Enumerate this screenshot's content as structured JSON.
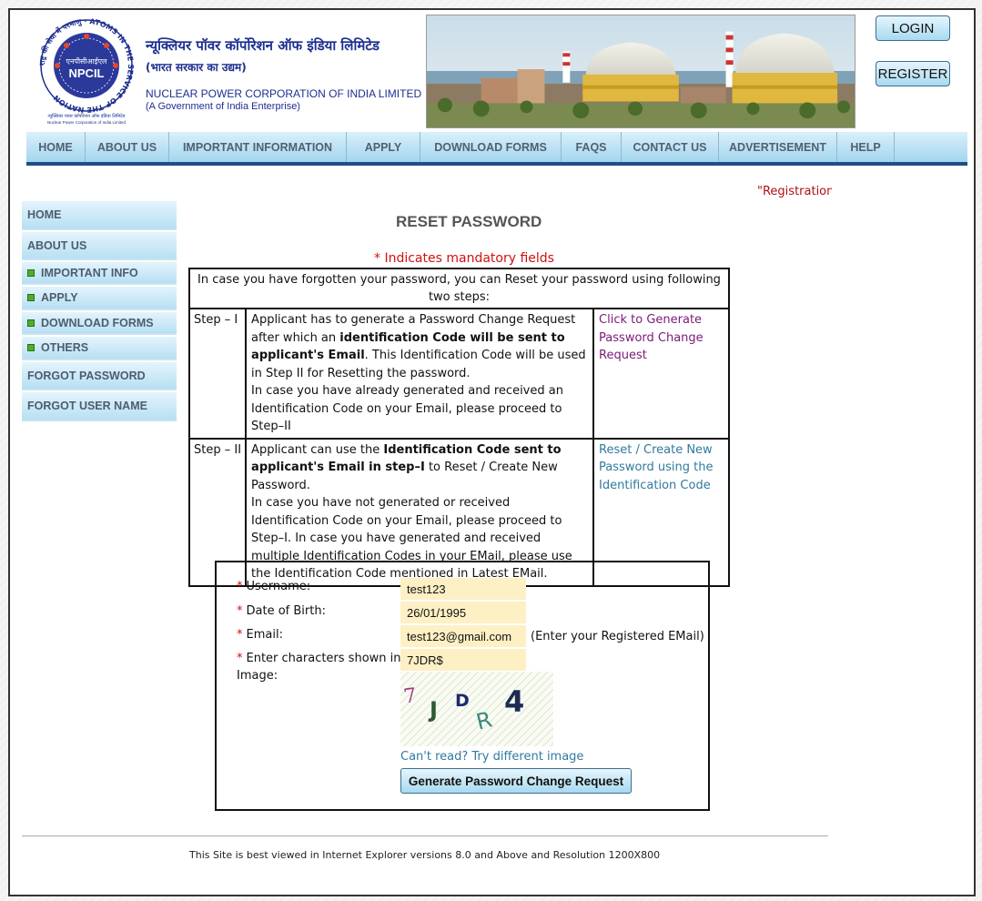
{
  "header": {
    "seal_ring_text": "राष्ट्र की सेवा में परमाणु · ATOMS IN THE SERVICE OF THE NATION",
    "seal_hindi": "एनपीसीआईएल",
    "seal_abbr": "NPCIL",
    "seal_caption_hi": "न्यूक्लियर पावर कॉर्पोरेशन ऑफ इंडिया लिमिटेड",
    "seal_caption_en": "Nuclear Power Corporation of India Limited",
    "title_hindi": "न्यूक्लियर पॉवर कॉर्पोरेशन ऑफ इंडिया लिमिटेड",
    "subtitle_hindi": "(भारत सरकार का उद्यम)",
    "title_english": "NUCLEAR POWER CORPORATION OF INDIA LIMITED",
    "subtitle_english": "(A Government of India Enterprise)",
    "login_label": "LOGIN",
    "register_label": "REGISTER"
  },
  "nav": {
    "items": [
      {
        "label": "HOME"
      },
      {
        "label": "ABOUT US"
      },
      {
        "label": "IMPORTANT INFORMATION"
      },
      {
        "label": "APPLY"
      },
      {
        "label": "DOWNLOAD FORMS"
      },
      {
        "label": "FAQS"
      },
      {
        "label": "CONTACT US"
      },
      {
        "label": "ADVERTISEMENT"
      },
      {
        "label": "HELP"
      }
    ]
  },
  "marquee": {
    "text": "\"Registration"
  },
  "sidebar": {
    "items": [
      {
        "label": "HOME"
      },
      {
        "label": "ABOUT US"
      },
      {
        "label": "IMPORTANT INFO"
      },
      {
        "label": "APPLY"
      },
      {
        "label": "DOWNLOAD FORMS"
      },
      {
        "label": "OTHERS"
      },
      {
        "label": "FORGOT PASSWORD"
      },
      {
        "label": "FORGOT USER NAME"
      }
    ]
  },
  "main": {
    "title": "RESET PASSWORD",
    "mandatory_note": "* Indicates mandatory fields",
    "intro": "In case you have forgotten your password, you can Reset your password using following two steps:",
    "step1": {
      "label": "Step – I",
      "t1": "Applicant has to generate a Password Change Request after which an ",
      "b1": "identification Code will be sent to applicant's Email",
      "t2": ". This Identification Code will be used in Step II for Resetting the password.",
      "t3": "In case you have already generated and received an Identification Code on your Email, please proceed to Step–II",
      "link": "Click to Generate Password Change Request"
    },
    "step2": {
      "label": "Step – II",
      "t1": "Applicant can use the ",
      "b1": "Identification Code sent to applicant's Email in step–I",
      "t2": " to Reset / Create New Password.",
      "t3": "In case you have not generated or received Identification Code on your Email, please proceed to Step–I. In case you have generated and received multiple Identification Codes in your EMail, please use the Identification Code mentioned in Latest EMail.",
      "link": "Reset / Create New Password using the Identification Code"
    }
  },
  "form": {
    "required_mark": "*",
    "username_label": "Username:",
    "username_value": "test123",
    "dob_label": "Date of Birth:",
    "dob_value": "26/01/1995",
    "email_label": "Email:",
    "email_value": "test123@gmail.com",
    "email_hint": "(Enter your Registered EMail)",
    "captcha_label_line1": "Enter characters shown in",
    "captcha_label_line2": "Image:",
    "captcha_value": "7JDR$",
    "captcha_chars": [
      "7",
      "J",
      "D",
      "R",
      "4"
    ],
    "refresh_link": "Can't read? Try different image",
    "submit_label": "Generate Password Change Request"
  },
  "footer": {
    "text": "This Site is best viewed in Internet Explorer versions 8.0 and Above and Resolution 1200X800"
  },
  "colors": {
    "brand_blue": "#1d2f8f",
    "nav_border": "#1d4f86",
    "link_purple": "#7b1a7a",
    "link_blue": "#2f7aa0",
    "required_red": "#d01010",
    "input_bg": "#fdf0c4"
  }
}
